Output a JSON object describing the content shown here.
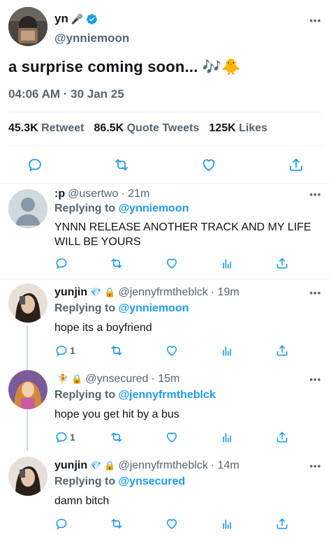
{
  "main_tweet": {
    "author_name": "yn",
    "author_handle": "@ynniemoon",
    "text": "a surprise coming soon... 🎶🐥",
    "timestamp": "04:06 AM · 30 Jan 25",
    "stats": [
      {
        "value": "45.3K",
        "label": "Retweet"
      },
      {
        "value": "86.5K",
        "label": "Quote Tweets"
      },
      {
        "value": "125K",
        "label": "Likes"
      }
    ],
    "more": "•••"
  },
  "replies": [
    {
      "name": ":p",
      "handle": "@usertwo",
      "time": "· 21m",
      "replying_prefix": "Replying to",
      "replying_to": "@ynniemoon",
      "text": "YNNN RELEASE ANOTHER TRACK AND MY LIFE WILL BE YOURS",
      "reply_count": ""
    },
    {
      "name": "yunjin",
      "handle": "@jennyfrmtheblck",
      "time": "· 19m",
      "replying_prefix": "Replying to",
      "replying_to": "@ynniemoon",
      "text": "hope its a boyfriend",
      "reply_count": "1"
    },
    {
      "name": "",
      "handle": "@ynsecured",
      "time": "· 15m",
      "replying_prefix": "Replying to",
      "replying_to": "@jennyfrmtheblck",
      "text": "hope you get hit by a bus",
      "reply_count": "1"
    },
    {
      "name": "yunjin",
      "handle": "@jennyfrmtheblck",
      "time": "· 14m",
      "replying_prefix": "Replying to",
      "replying_to": "@ynsecured",
      "text": "damn bitch",
      "reply_count": ""
    }
  ],
  "colors": {
    "accent": "#1d9bf0",
    "secondary_text": "#536471",
    "primary_text": "#0f1419",
    "divider": "#eff3f4"
  }
}
